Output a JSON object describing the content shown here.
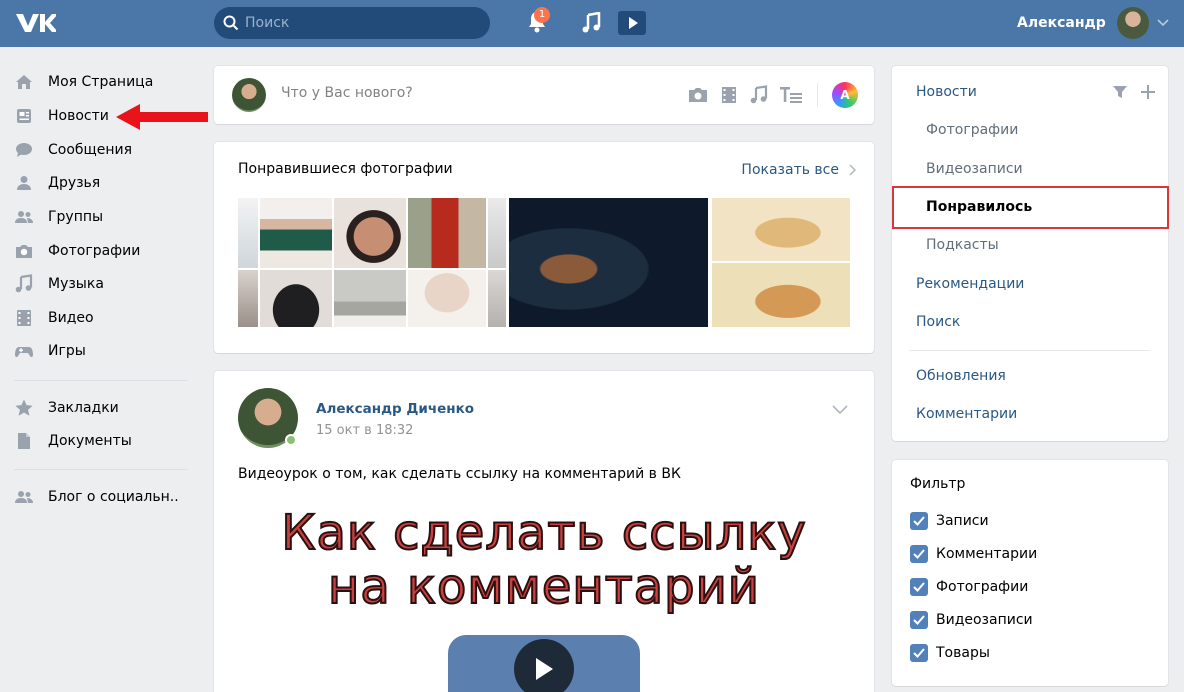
{
  "header": {
    "logo": "VK",
    "search_placeholder": "Поиск",
    "notifications_count": "1",
    "user_name": "Александр"
  },
  "leftnav": {
    "items": [
      {
        "label": "Моя Страница",
        "icon": "home-icon"
      },
      {
        "label": "Новости",
        "icon": "news-icon"
      },
      {
        "label": "Сообщения",
        "icon": "messages-icon"
      },
      {
        "label": "Друзья",
        "icon": "friends-icon"
      },
      {
        "label": "Группы",
        "icon": "groups-icon"
      },
      {
        "label": "Фотографии",
        "icon": "camera-icon"
      },
      {
        "label": "Музыка",
        "icon": "music-icon"
      },
      {
        "label": "Видео",
        "icon": "video-icon"
      },
      {
        "label": "Игры",
        "icon": "gamepad-icon"
      }
    ],
    "extra": [
      {
        "label": "Закладки",
        "icon": "star-icon"
      },
      {
        "label": "Документы",
        "icon": "document-icon"
      }
    ],
    "community": {
      "label": "Блог о социальн..",
      "icon": "community-icon"
    }
  },
  "post_box": {
    "placeholder": "Что у Вас нового?",
    "avatar_letter": "A"
  },
  "liked_photos": {
    "title": "Понравившиеся фотографии",
    "show_all": "Показать все"
  },
  "post": {
    "author": "Александр Диченко",
    "date": "15 окт в 18:32",
    "text": "Видеоурок о том, как сделать ссылку на комментарий в ВК",
    "thumb_line1": "Как сделать ссылку",
    "thumb_line2": "на комментарий"
  },
  "right_menu": {
    "news": "Новости",
    "sub": [
      "Фотографии",
      "Видеозаписи",
      "Понравилось",
      "Подкасты"
    ],
    "recommendations": "Рекомендации",
    "search": "Поиск",
    "updates": "Обновления",
    "comments": "Комментарии"
  },
  "filter": {
    "title": "Фильтр",
    "options": [
      "Записи",
      "Комментарии",
      "Фотографии",
      "Видеозаписи",
      "Товары"
    ]
  },
  "colors": {
    "header": "#4a76a8",
    "link": "#2a5885",
    "highlight_border": "#d9363e",
    "checkbox": "#5181b8",
    "arrow": "#e8141a"
  }
}
